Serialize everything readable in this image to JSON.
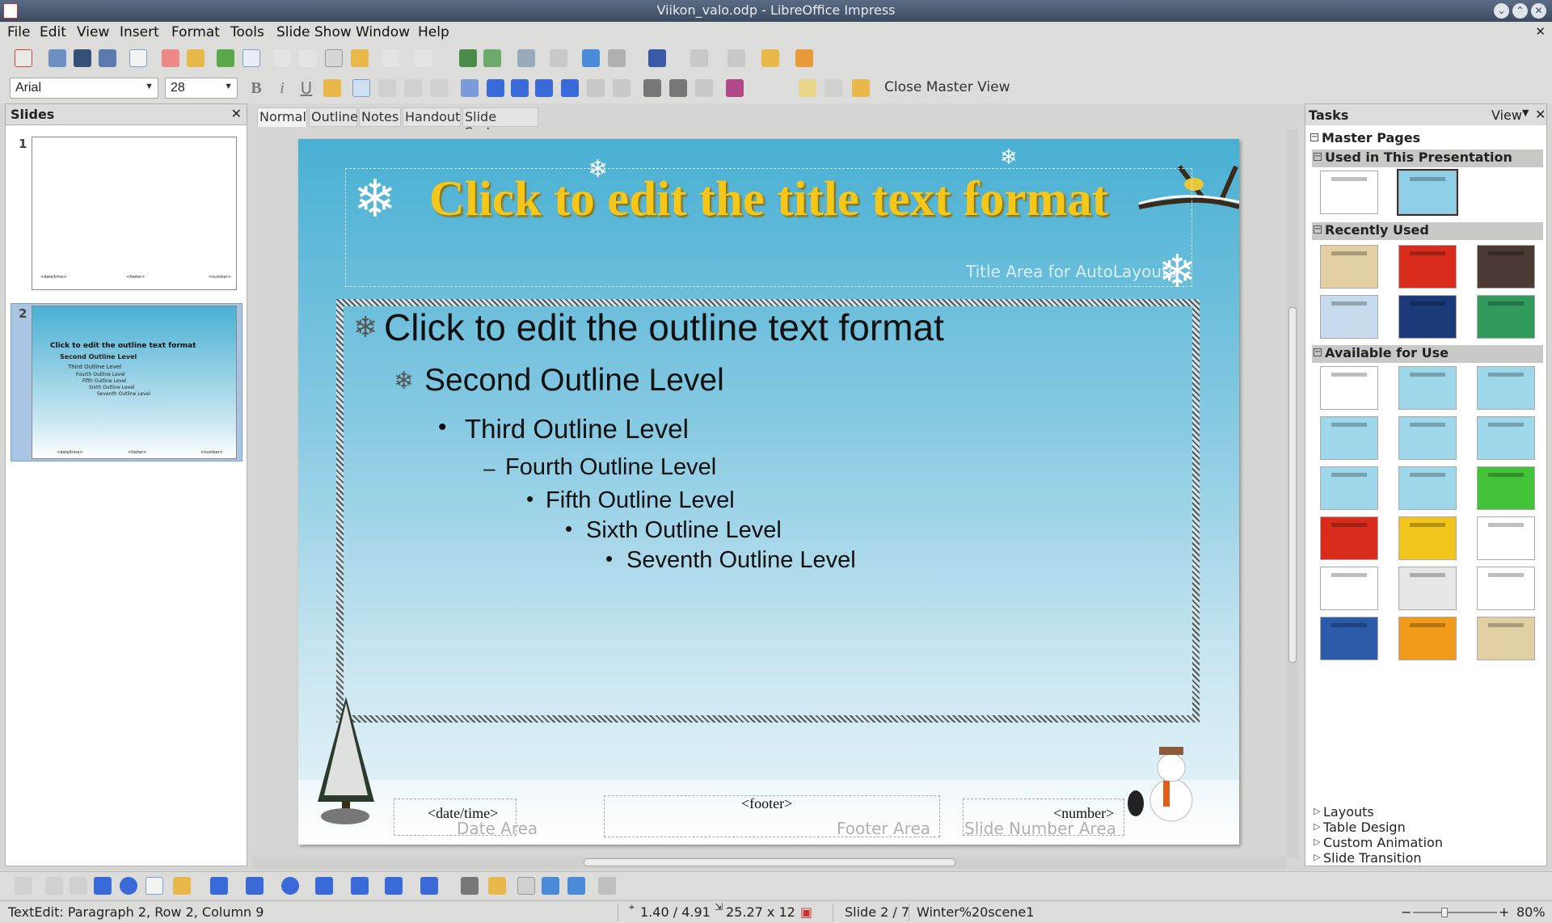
{
  "window": {
    "title": "Viikon_valo.odp - LibreOffice Impress"
  },
  "menu": [
    "File",
    "Edit",
    "View",
    "Insert",
    "Format",
    "Tools",
    "Slide Show",
    "Window",
    "Help"
  ],
  "doc_close": "✕",
  "format_bar": {
    "font_name": "Arial",
    "font_size": "28",
    "close_master_label": "Close Master View"
  },
  "slides_pane": {
    "title": "Slides",
    "close": "✕",
    "slides": [
      {
        "number": "1"
      },
      {
        "number": "2"
      }
    ]
  },
  "view_tabs": [
    "Normal",
    "Outline",
    "Notes",
    "Handout",
    "Slide Sorter"
  ],
  "slide": {
    "title": "Click to edit the title text format",
    "title_hint": "Title Area for AutoLayouts",
    "outline": [
      {
        "text": "Click to edit the outline text format",
        "bullet": "❄"
      },
      {
        "text": "Second Outline Level",
        "bullet": "❄"
      },
      {
        "text": "Third Outline Level",
        "bullet": "•"
      },
      {
        "text": "Fourth Outline Level",
        "bullet": "–"
      },
      {
        "text": "Fifth Outline Level",
        "bullet": "•"
      },
      {
        "text": "Sixth Outline Level",
        "bullet": "•"
      },
      {
        "text": "Seventh Outline Level",
        "bullet": "•"
      }
    ],
    "footer": {
      "date_field": "<date/time>",
      "date_hint": "Date Area",
      "footer_field": "<footer>",
      "footer_hint": "Footer Area",
      "number_field": "<number>",
      "number_hint": "Slide Number Area"
    }
  },
  "thumb2": {
    "title": "Click to edit the outline text format",
    "lines": [
      "Second Outline Level",
      "Third Outline Level",
      "Fourth Outline Level",
      "Fifth Outline Level",
      "Sixth Outline Level",
      "Seventh Outline Level"
    ],
    "footer": [
      "<date/time>",
      "<footer>",
      "<number>"
    ]
  },
  "thumb1": {
    "footer": [
      "<date/time>",
      "<footer>",
      "<number>"
    ]
  },
  "tasks_pane": {
    "title": "Tasks",
    "view_label": "View",
    "master_pages": "Master Pages",
    "used": "Used in This Presentation",
    "recently": "Recently Used",
    "available": "Available for Use",
    "collapsed": [
      "Layouts",
      "Table Design",
      "Custom Animation",
      "Slide Transition"
    ],
    "used_colors": [
      "#ffffff",
      "#8fd0e8"
    ],
    "recent_colors": [
      "#e2cfa4",
      "#d92c1c",
      "#4a3a33",
      "#c6dcee",
      "#1a3a7a",
      "#2f9a5a"
    ],
    "available_colors": [
      "#ffffff",
      "#9fd7ea",
      "#9fd7ea",
      "#9fd7ea",
      "#9fd7ea",
      "#9fd7ea",
      "#9fd7ea",
      "#9fd7ea",
      "#44c23a",
      "#d92c1c",
      "#f2c51c",
      "#ffffff",
      "#ffffff",
      "#e6e6e6",
      "#ffffff",
      "#2a5aa8",
      "#f29a1a",
      "#e2cfa4"
    ]
  },
  "statusbar": {
    "text_edit": "TextEdit: Paragraph 2, Row 2, Column 9",
    "position": "1.40 / 4.91",
    "size": "25.27 x 12",
    "slide": "Slide 2 / 7",
    "master": "Winter%20scene1",
    "zoom": "80%"
  }
}
